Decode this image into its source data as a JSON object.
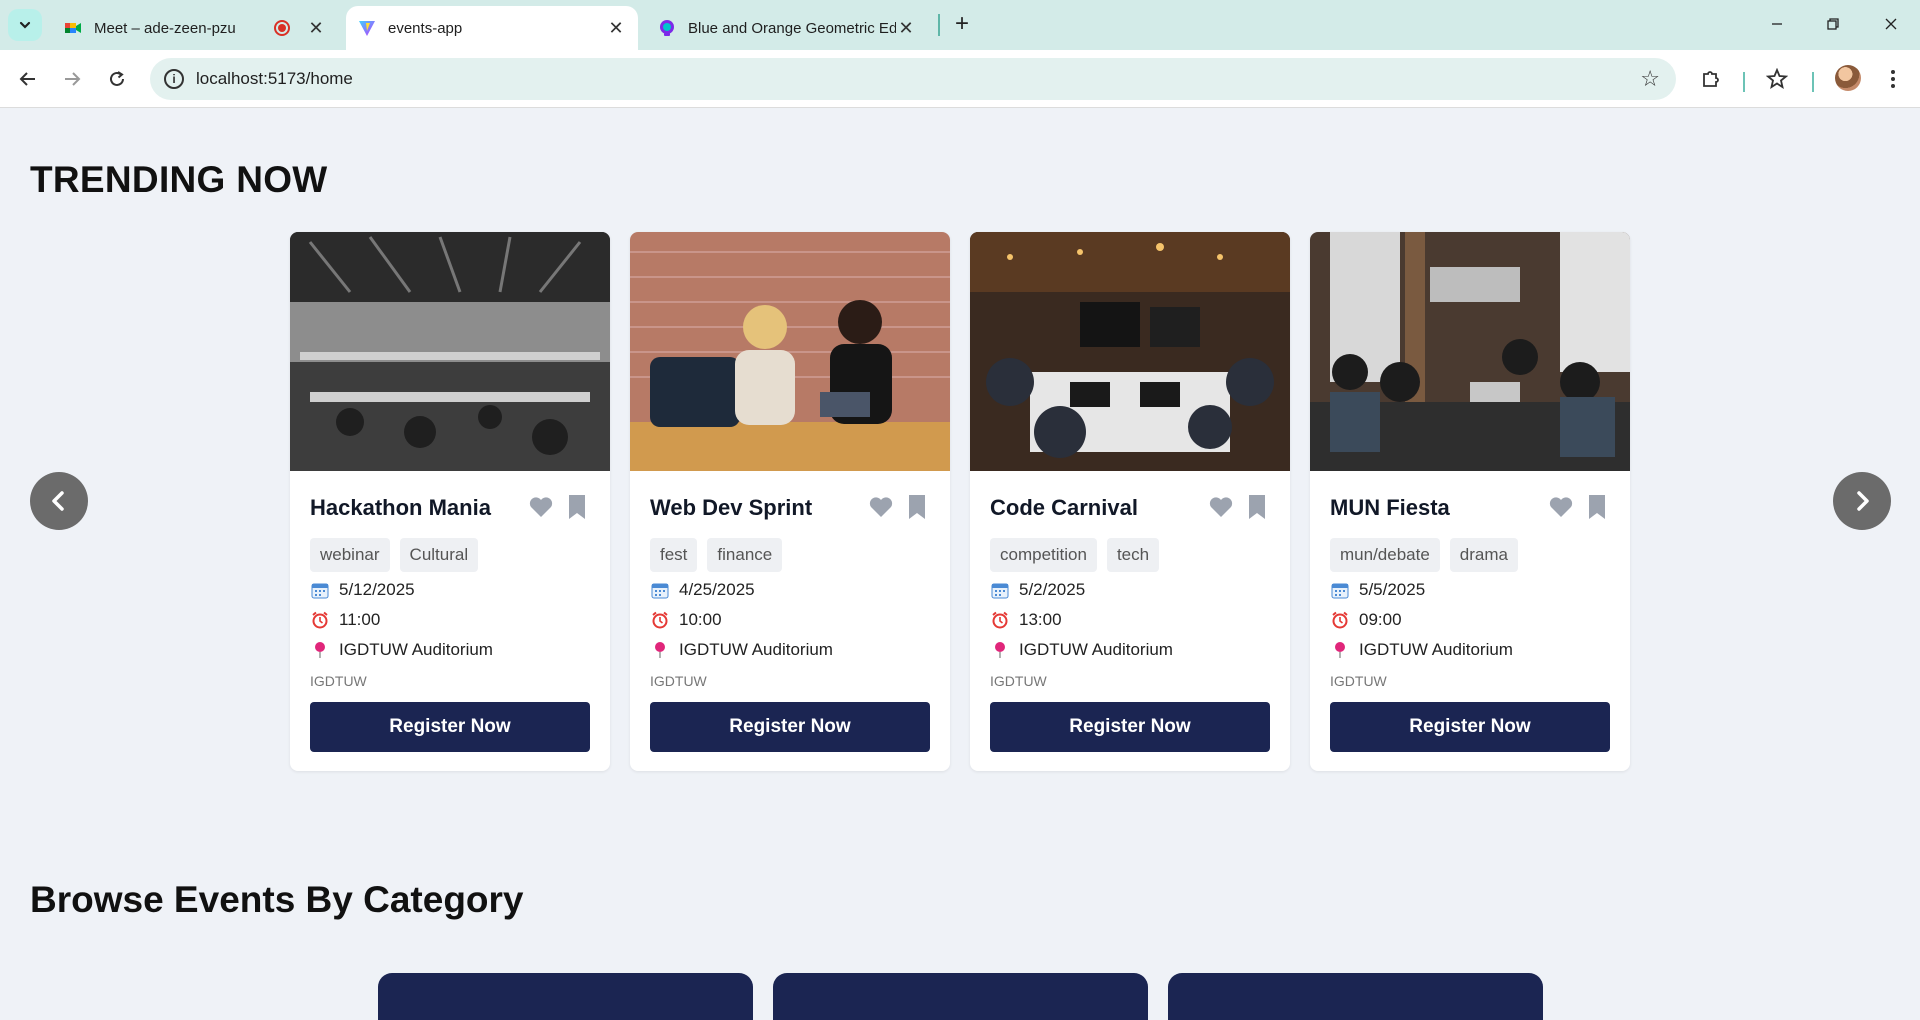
{
  "browser": {
    "tabs": [
      {
        "label": "Meet – ade-zeen-pzu",
        "active": false
      },
      {
        "label": "events-app",
        "active": true
      },
      {
        "label": "Blue and Orange Geometric Edu",
        "active": false
      }
    ],
    "url": "localhost:5173/home"
  },
  "page": {
    "trending_title": "TRENDING NOW",
    "browse_title": "Browse Events By Category",
    "events": [
      {
        "title": "Hackathon Mania",
        "tags": [
          "webinar",
          "Cultural"
        ],
        "date": "5/12/2025",
        "time": "11:00",
        "venue": "IGDTUW Auditorium",
        "org": "IGDTUW",
        "button": "Register Now"
      },
      {
        "title": "Web Dev Sprint",
        "tags": [
          "fest",
          "finance"
        ],
        "date": "4/25/2025",
        "time": "10:00",
        "venue": "IGDTUW Auditorium",
        "org": "IGDTUW",
        "button": "Register Now"
      },
      {
        "title": "Code Carnival",
        "tags": [
          "competition",
          "tech"
        ],
        "date": "5/2/2025",
        "time": "13:00",
        "venue": "IGDTUW Auditorium",
        "org": "IGDTUW",
        "button": "Register Now"
      },
      {
        "title": "MUN Fiesta",
        "tags": [
          "mun/debate",
          "drama"
        ],
        "date": "5/5/2025",
        "time": "09:00",
        "venue": "IGDTUW Auditorium",
        "org": "IGDTUW",
        "button": "Register Now"
      }
    ]
  },
  "colors": {
    "primary": "#1b2552",
    "background": "#eff2f7",
    "tab_strip": "#d3ebe8",
    "icon_gray": "#9ca3af"
  },
  "icons": [
    "calendar-icon",
    "alarm-clock-icon",
    "pin-icon",
    "heart-icon",
    "bookmark-icon",
    "chevron-left-icon",
    "chevron-right-icon"
  ]
}
